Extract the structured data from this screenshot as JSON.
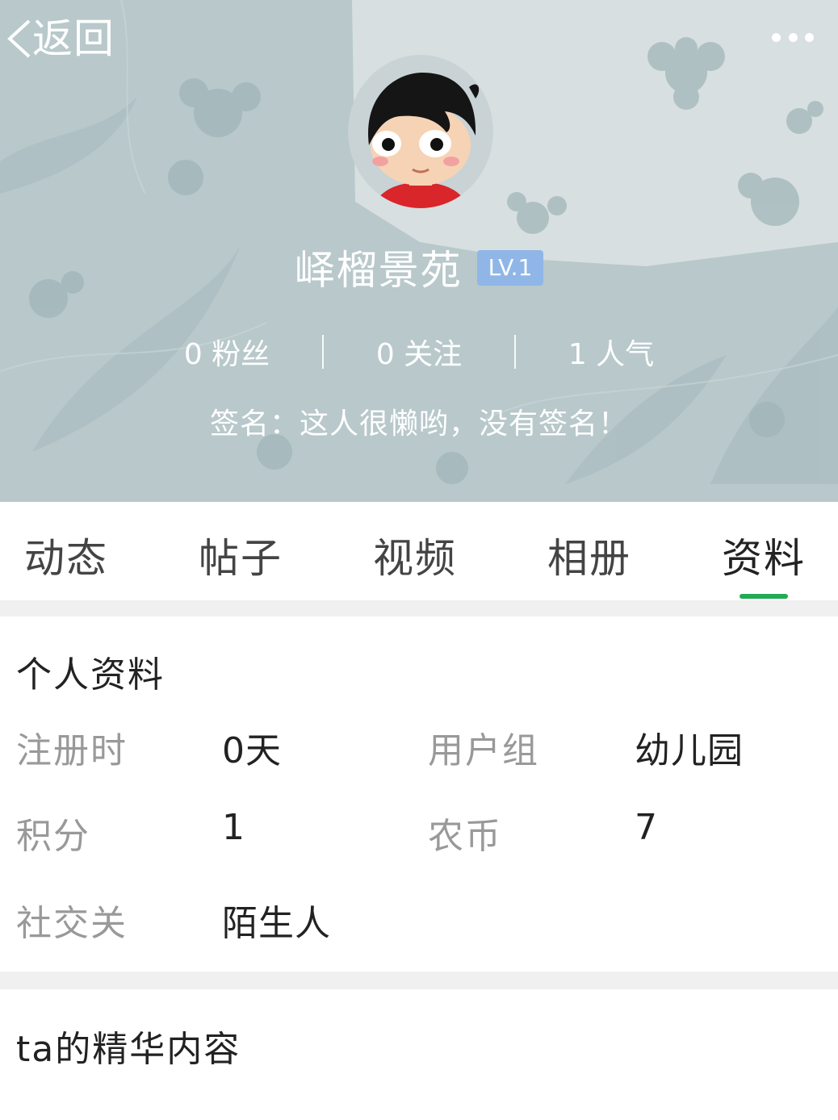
{
  "header": {
    "back_label": "返回",
    "user_name": "峄榴景苑",
    "level": "LV.1",
    "stats": [
      {
        "label": "0 粉丝"
      },
      {
        "label": "0 关注"
      },
      {
        "label": "1 人气"
      }
    ],
    "signature": "签名：这人很懒哟，没有签名！"
  },
  "tabs": [
    {
      "label": "动态"
    },
    {
      "label": "帖子"
    },
    {
      "label": "视频"
    },
    {
      "label": "相册"
    },
    {
      "label": "资料",
      "active": true
    }
  ],
  "profile": {
    "title": "个人资料",
    "fields": [
      {
        "label": "注册时",
        "value": "0天"
      },
      {
        "label": "用户组",
        "value": "幼儿园"
      },
      {
        "label": "积分",
        "value": "1"
      },
      {
        "label": "农币",
        "value": "7"
      },
      {
        "label": "社交关",
        "value": "陌生人"
      }
    ]
  },
  "featured": {
    "title": "ta的精华内容"
  },
  "colors": {
    "accent": "#22aa55",
    "level_badge": "#8fb6e6",
    "header_bg": "#b9c9cc"
  }
}
